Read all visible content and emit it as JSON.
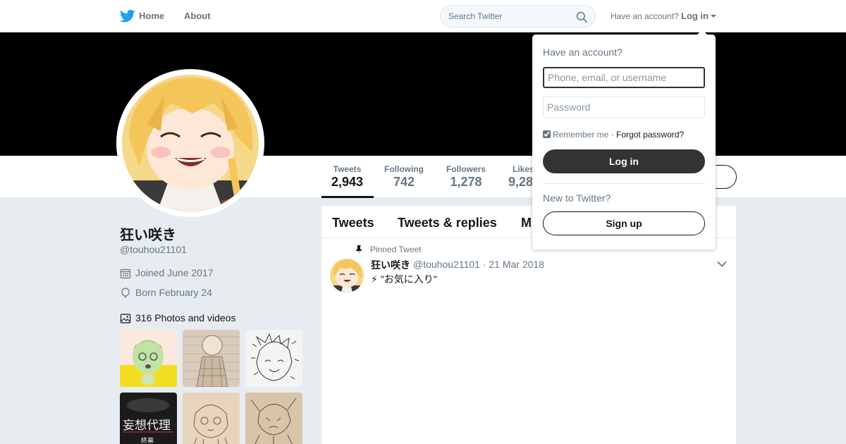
{
  "nav": {
    "home_label": "Home",
    "about_label": "About",
    "search_placeholder": "Search Twitter",
    "have_account": "Have an account?",
    "login_label": "Log in",
    "icons": [
      "twitter-logo-icon",
      "search-icon",
      "caret-down-icon"
    ]
  },
  "profile": {
    "name": "狂い咲き",
    "handle": "@touhou21101",
    "joined": "Joined June 2017",
    "born": "Born February 24",
    "photos_label": "316 Photos and videos"
  },
  "stats": [
    {
      "label": "Tweets",
      "value": "2,943"
    },
    {
      "label": "Following",
      "value": "742"
    },
    {
      "label": "Followers",
      "value": "1,278"
    },
    {
      "label": "Likes",
      "value": "9,28"
    }
  ],
  "timeline": {
    "tabs": [
      "Tweets",
      "Tweets & replies",
      "M"
    ],
    "pinned_label": "Pinned Tweet",
    "tweet": {
      "name": "狂い咲き",
      "handle_date": "@touhou21101 · 21 Mar 2018",
      "text": "⚡ \"お気に入り\""
    }
  },
  "login_dropdown": {
    "title": "Have an account?",
    "username_placeholder": "Phone, email, or username",
    "password_placeholder": "Password",
    "remember_label": "Remember me",
    "separator": "·",
    "forgot_label": "Forgot password?",
    "login_button": "Log in",
    "new_label": "New to Twitter?",
    "signup_button": "Sign up"
  },
  "colors": {
    "twitter_blue": "#1da1f2",
    "banner": "#000000",
    "page_bg": "#e6ecf0",
    "dark_button": "#333333"
  }
}
